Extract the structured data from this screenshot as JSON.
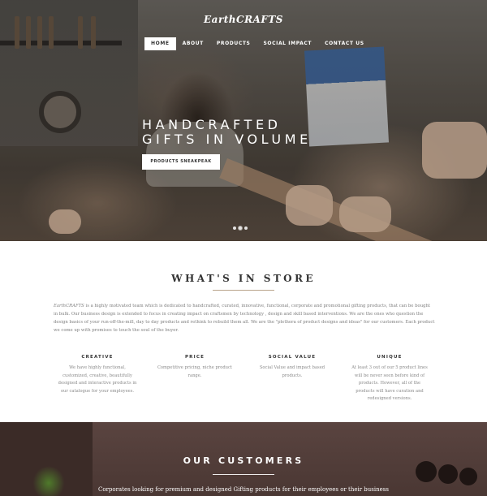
{
  "brand": {
    "logo": "EarthCRAFTS"
  },
  "nav": {
    "items": [
      {
        "label": "HOME",
        "active": true
      },
      {
        "label": "ABOUT",
        "active": false
      },
      {
        "label": "PRODUCTS",
        "active": false
      },
      {
        "label": "SOCIAL IMPACT",
        "active": false
      },
      {
        "label": "CONTACT US",
        "active": false
      }
    ]
  },
  "hero": {
    "title_line1": "HANDCRAFTED",
    "title_line2": "GIFTS IN VOLUME",
    "cta": "PRODUCTS SNEAKPEAK",
    "slides": 3,
    "current_slide": 2
  },
  "store": {
    "title": "WHAT'S IN STORE",
    "intro_brand": "EarthCRAFTS",
    "intro_text": " is a highly motivated team which is dedicated to handcrafted, curated, innovative, functional, corporate and promotional gifting products, that can be bought in bulk. Our business design is extended to focus in creating impact on craftsmen by technology , design and skill based interventions. We are the ones who question the design basics of your run-off-the-mill, day to day products and rethink to rebuild them all. We are the \"plethora of product designs and ideas\" for our customers. Each product we come up with promises to touch the soul of the buyer.",
    "features": [
      {
        "title": "CREATIVE",
        "text": "We have highly functional, customized, creative, beautifully designed and interactive products in our catalogue for your employees."
      },
      {
        "title": "PRICE",
        "text": "Competitive pricing, niche product range."
      },
      {
        "title": "SOCIAL VALUE",
        "text": "Social Value and impact based products."
      },
      {
        "title": "UNIQUE",
        "text": "At least 3 out of our 5 product lines will be never seen before kind of products. However, all of the products will have curation and redesigned versions."
      }
    ]
  },
  "customers": {
    "title": "OUR CUSTOMERS",
    "text": "Corporates looking for premium and designed Gifting products for their employees or their business"
  },
  "colors": {
    "accent_rule": "#b8a48a",
    "customers_bg": "#4a3733",
    "heading": "#333333",
    "body_text": "#808080"
  }
}
